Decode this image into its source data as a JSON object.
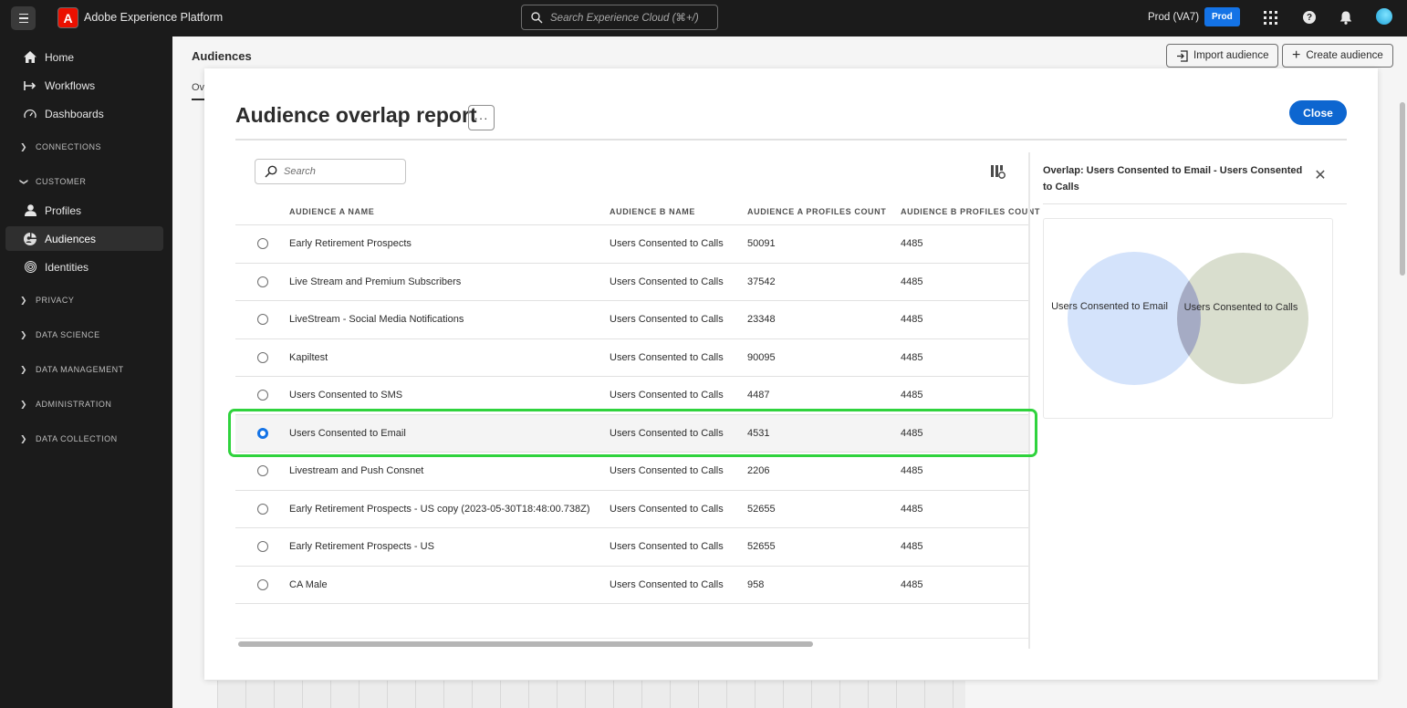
{
  "topbar": {
    "app_title": "Adobe Experience Platform",
    "search_placeholder": "Search Experience Cloud (⌘+/)",
    "org_label": "Prod (VA7)",
    "sandbox_badge": "Prod"
  },
  "sidebar": {
    "items": [
      {
        "label": "Home",
        "icon": "home-icon"
      },
      {
        "label": "Workflows",
        "icon": "workflows-icon"
      },
      {
        "label": "Dashboards",
        "icon": "dashboard-icon"
      },
      {
        "label": "Profiles",
        "icon": "user-icon"
      },
      {
        "label": "Audiences",
        "icon": "audiences-icon"
      },
      {
        "label": "Identities",
        "icon": "fingerprint-icon"
      }
    ],
    "sections": [
      "CONNECTIONS",
      "CUSTOMER",
      "PRIVACY",
      "DATA SCIENCE",
      "DATA MANAGEMENT",
      "ADMINISTRATION",
      "DATA COLLECTION"
    ]
  },
  "page": {
    "title": "Audiences",
    "tab_fragment": "Ov",
    "import_button": "Import audience",
    "create_button": "Create audience"
  },
  "modal": {
    "title": "Audience overlap report",
    "more_label": "···",
    "close_label": "Close",
    "search_placeholder": "Search",
    "columns": [
      "AUDIENCE A NAME",
      "AUDIENCE B NAME",
      "AUDIENCE A PROFILES COUNT",
      "AUDIENCE B PROFILES COUNT"
    ],
    "rows": [
      {
        "a_name": "Early Retirement Prospects",
        "b_name": "Users Consented to Calls",
        "a_count": "50091",
        "b_count": "4485",
        "selected": false
      },
      {
        "a_name": "Live Stream and Premium Subscribers",
        "b_name": "Users Consented to Calls",
        "a_count": "37542",
        "b_count": "4485",
        "selected": false
      },
      {
        "a_name": "LiveStream - Social Media Notifications",
        "b_name": "Users Consented to Calls",
        "a_count": "23348",
        "b_count": "4485",
        "selected": false
      },
      {
        "a_name": "Kapiltest",
        "b_name": "Users Consented to Calls",
        "a_count": "90095",
        "b_count": "4485",
        "selected": false
      },
      {
        "a_name": "Users Consented to SMS",
        "b_name": "Users Consented to Calls",
        "a_count": "4487",
        "b_count": "4485",
        "selected": false
      },
      {
        "a_name": "Users Consented to Email",
        "b_name": "Users Consented to Calls",
        "a_count": "4531",
        "b_count": "4485",
        "selected": true
      },
      {
        "a_name": "Livestream and Push Consnet",
        "b_name": "Users Consented to Calls",
        "a_count": "2206",
        "b_count": "4485",
        "selected": false
      },
      {
        "a_name": "Early Retirement Prospects - US copy (2023-05-30T18:48:00.738Z)",
        "b_name": "Users Consented to Calls",
        "a_count": "52655",
        "b_count": "4485",
        "selected": false
      },
      {
        "a_name": "Early Retirement Prospects - US",
        "b_name": "Users Consented to Calls",
        "a_count": "52655",
        "b_count": "4485",
        "selected": false
      },
      {
        "a_name": "CA Male",
        "b_name": "Users Consented to Calls",
        "a_count": "958",
        "b_count": "4485",
        "selected": false
      }
    ],
    "panel": {
      "title": "Overlap: Users Consented to Email - Users Consented to Calls",
      "venn": {
        "left_label": "Users Consented to Email",
        "right_label": "Users Consented to Calls",
        "left_color": "#d4e3fb",
        "right_color": "#d9dece",
        "overlap_color": "#a5abc4"
      }
    }
  },
  "colors": {
    "accent": "#1473e6",
    "close_button": "#0d66d0",
    "highlight": "#2fd33d",
    "shell": "#1b1b1b"
  }
}
